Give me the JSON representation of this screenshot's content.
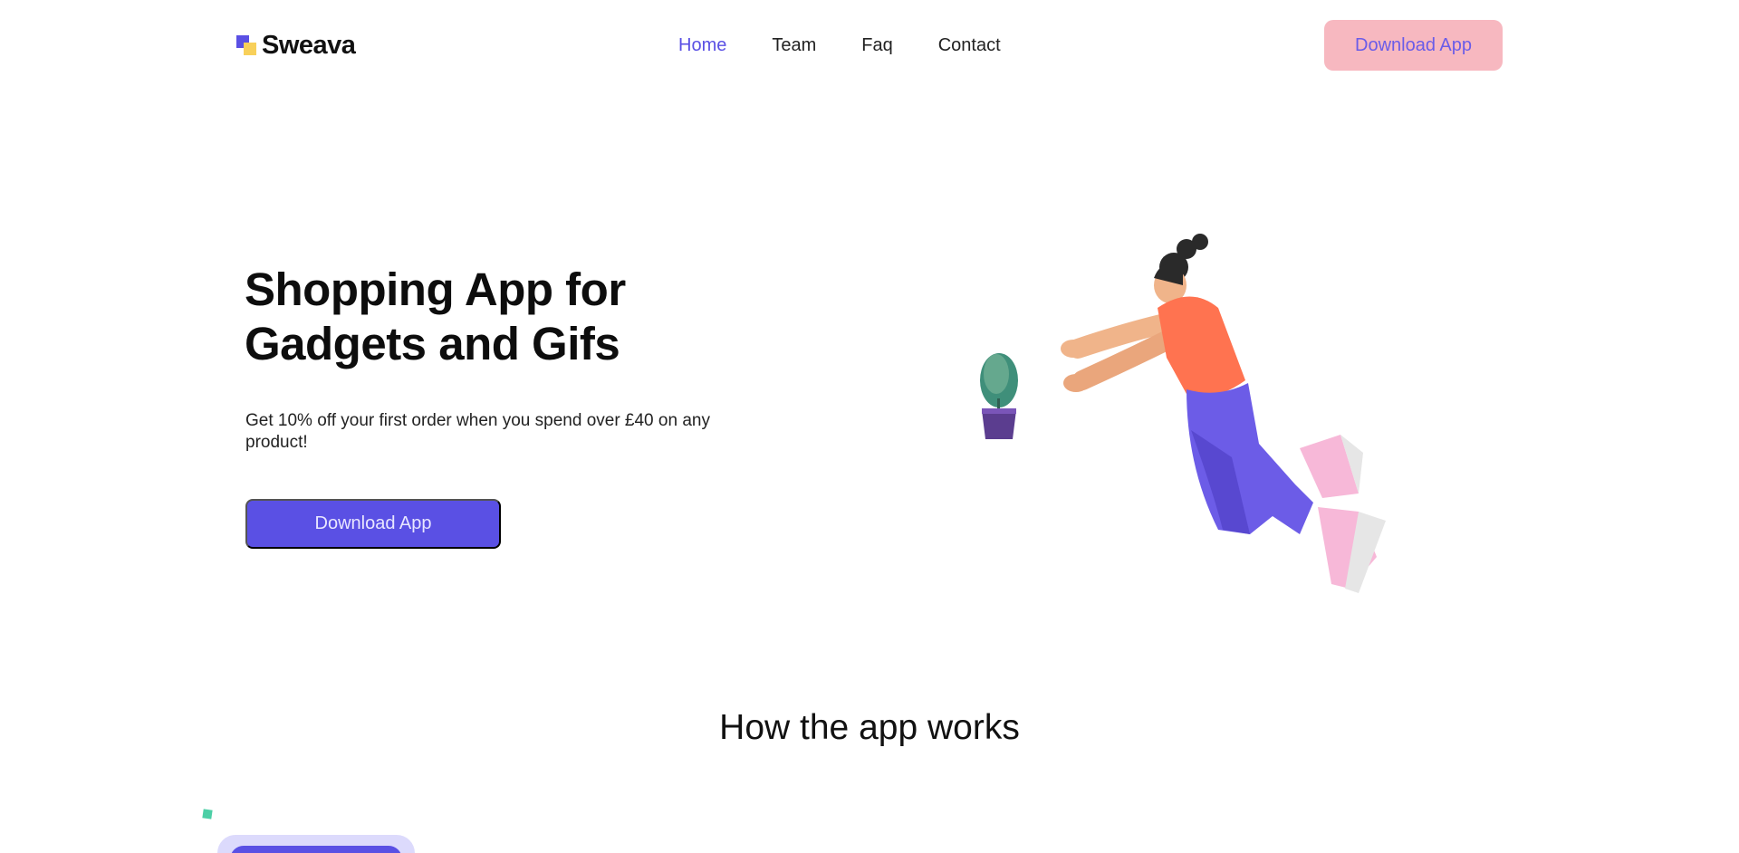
{
  "brand": {
    "name": "Sweava"
  },
  "nav": {
    "items": [
      {
        "label": "Home"
      },
      {
        "label": "Team"
      },
      {
        "label": "Faq"
      },
      {
        "label": "Contact"
      }
    ]
  },
  "header": {
    "cta_label": "Download App"
  },
  "hero": {
    "title_line1": "Shopping App for",
    "title_line2": "Gadgets and Gifs",
    "subtitle": "Get 10% off your first order when you spend over £40 on any product!",
    "cta_label": "Download App"
  },
  "section": {
    "title": "How the app works"
  },
  "colors": {
    "accent": "#5a50e4",
    "pink": "#f7b8c0",
    "yellow": "#f8d05a",
    "teal": "#4ccfa6"
  }
}
